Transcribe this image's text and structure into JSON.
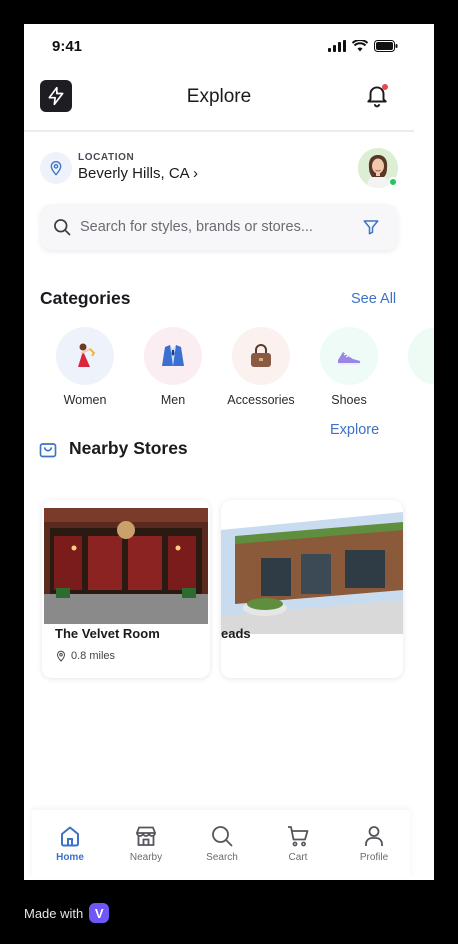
{
  "status": {
    "time": "9:41"
  },
  "header": {
    "title": "Explore"
  },
  "location": {
    "caption": "LOCATION",
    "value": "Beverly Hills, CA ›"
  },
  "search": {
    "placeholder": "Search for styles, brands or stores..."
  },
  "categories": {
    "title": "Categories",
    "see_all": "See All",
    "items": [
      {
        "label": "Women",
        "icon": "woman-dress-icon",
        "bg": "#eef3fb"
      },
      {
        "label": "Men",
        "icon": "suit-jacket-icon",
        "bg": "#fbeef2"
      },
      {
        "label": "Accessories",
        "icon": "handbag-icon",
        "bg": "#fbf1ee"
      },
      {
        "label": "Shoes",
        "icon": "sneaker-icon",
        "bg": "#eefbf6"
      }
    ]
  },
  "explore_link": "Explore",
  "nearby": {
    "title": "Nearby Stores",
    "stores": [
      {
        "name": "The Velvet Room",
        "distance": "0.8 miles"
      },
      {
        "name": "eads"
      }
    ]
  },
  "tabbar": {
    "items": [
      {
        "label": "Home",
        "icon": "home-icon",
        "active": true
      },
      {
        "label": "Nearby",
        "icon": "store-icon"
      },
      {
        "label": "Search",
        "icon": "search-icon"
      },
      {
        "label": "Cart",
        "icon": "cart-icon"
      },
      {
        "label": "Profile",
        "icon": "profile-icon"
      }
    ]
  },
  "footer": {
    "made_with": "Made with",
    "badge": "V"
  },
  "colors": {
    "accent": "#3d72c7",
    "online": "#22c55e",
    "notification": "#e5484d"
  }
}
